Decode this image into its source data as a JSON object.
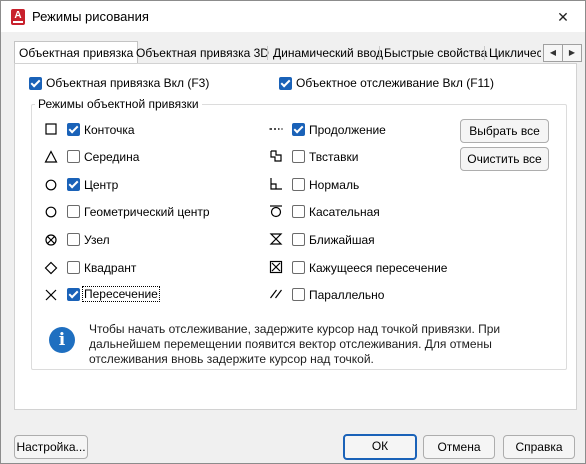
{
  "window": {
    "title": "Режимы рисования",
    "close_glyph": "✕"
  },
  "tabs": [
    {
      "label": "Объектная привязка",
      "active": true
    },
    {
      "label": "Объектная привязка 3D"
    },
    {
      "label": "Динамический ввод"
    },
    {
      "label": "Быстрые свойства"
    },
    {
      "label": "Циклическ"
    }
  ],
  "tab_scroll": {
    "left": "◀",
    "right": "▶"
  },
  "top_options": {
    "osnap_on": {
      "label": "Объектная привязка Вкл (F3)",
      "checked": true
    },
    "otrack_on": {
      "label": "Объектное отслеживание Вкл (F11)",
      "checked": true
    }
  },
  "group_title": "Режимы объектной привязки",
  "modes_left": [
    {
      "label": "Конточка",
      "checked": true,
      "icon": "square-endpoint-icon"
    },
    {
      "label": "Середина",
      "checked": false,
      "icon": "triangle-midpoint-icon"
    },
    {
      "label": "Центр",
      "checked": true,
      "icon": "circle-center-icon"
    },
    {
      "label": "Геометрический центр",
      "checked": false,
      "icon": "circle-geocenter-icon"
    },
    {
      "label": "Узел",
      "checked": false,
      "icon": "node-icon"
    },
    {
      "label": "Квадрант",
      "checked": false,
      "icon": "diamond-quadrant-icon"
    },
    {
      "label": "Пересечение",
      "checked": true,
      "icon": "cross-intersection-icon"
    }
  ],
  "modes_right": [
    {
      "label": "Продолжение",
      "checked": true,
      "icon": "extension-icon"
    },
    {
      "label": "Твставки",
      "checked": false,
      "icon": "insert-icon"
    },
    {
      "label": "Нормаль",
      "checked": false,
      "icon": "perpendicular-icon"
    },
    {
      "label": "Касательная",
      "checked": false,
      "icon": "tangent-icon"
    },
    {
      "label": "Ближайшая",
      "checked": false,
      "icon": "nearest-icon"
    },
    {
      "label": "Кажущееся пересечение",
      "checked": false,
      "icon": "apparent-intersection-icon"
    },
    {
      "label": "Параллельно",
      "checked": false,
      "icon": "parallel-icon"
    }
  ],
  "buttons": {
    "select_all": "Выбрать все",
    "clear_all": "Очистить все",
    "settings": "Настройка...",
    "ok": "ОК",
    "cancel": "Отмена",
    "help": "Справка"
  },
  "info": {
    "icon": "info-icon",
    "text": "Чтобы начать отслеживание, задержите курсор над точкой привязки. При дальнейшем перемещении появится вектор отслеживания. Для отмены отслеживания вновь задержите курсор над точкой."
  },
  "colors": {
    "accent": "#1a62b8",
    "app_icon": "#c8202c"
  }
}
